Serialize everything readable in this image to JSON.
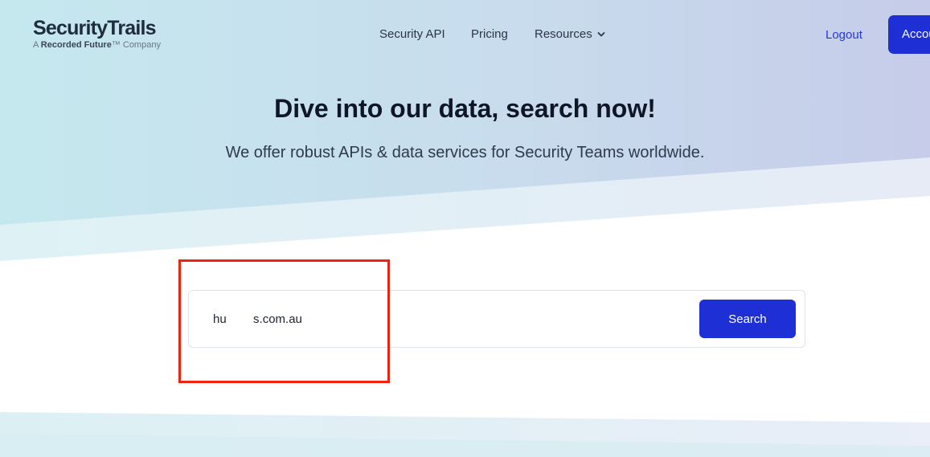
{
  "brand": {
    "name": "SecurityTrails",
    "tagline_prefix": "A ",
    "tagline_bold": "Recorded Future",
    "tagline_suffix": "™ Company"
  },
  "nav": {
    "items": [
      {
        "label": "Security API"
      },
      {
        "label": "Pricing"
      },
      {
        "label": "Resources"
      }
    ],
    "logout_label": "Logout",
    "account_label": "Account"
  },
  "hero": {
    "title": "Dive into our data, search now!",
    "subtitle": "We offer robust APIs & data services for Security Teams worldwide."
  },
  "search": {
    "value": "hu        s.com.au",
    "button_label": "Search"
  },
  "colors": {
    "accent": "#1e2fd6",
    "link": "#2438d9",
    "annotation": "#f0210e"
  }
}
